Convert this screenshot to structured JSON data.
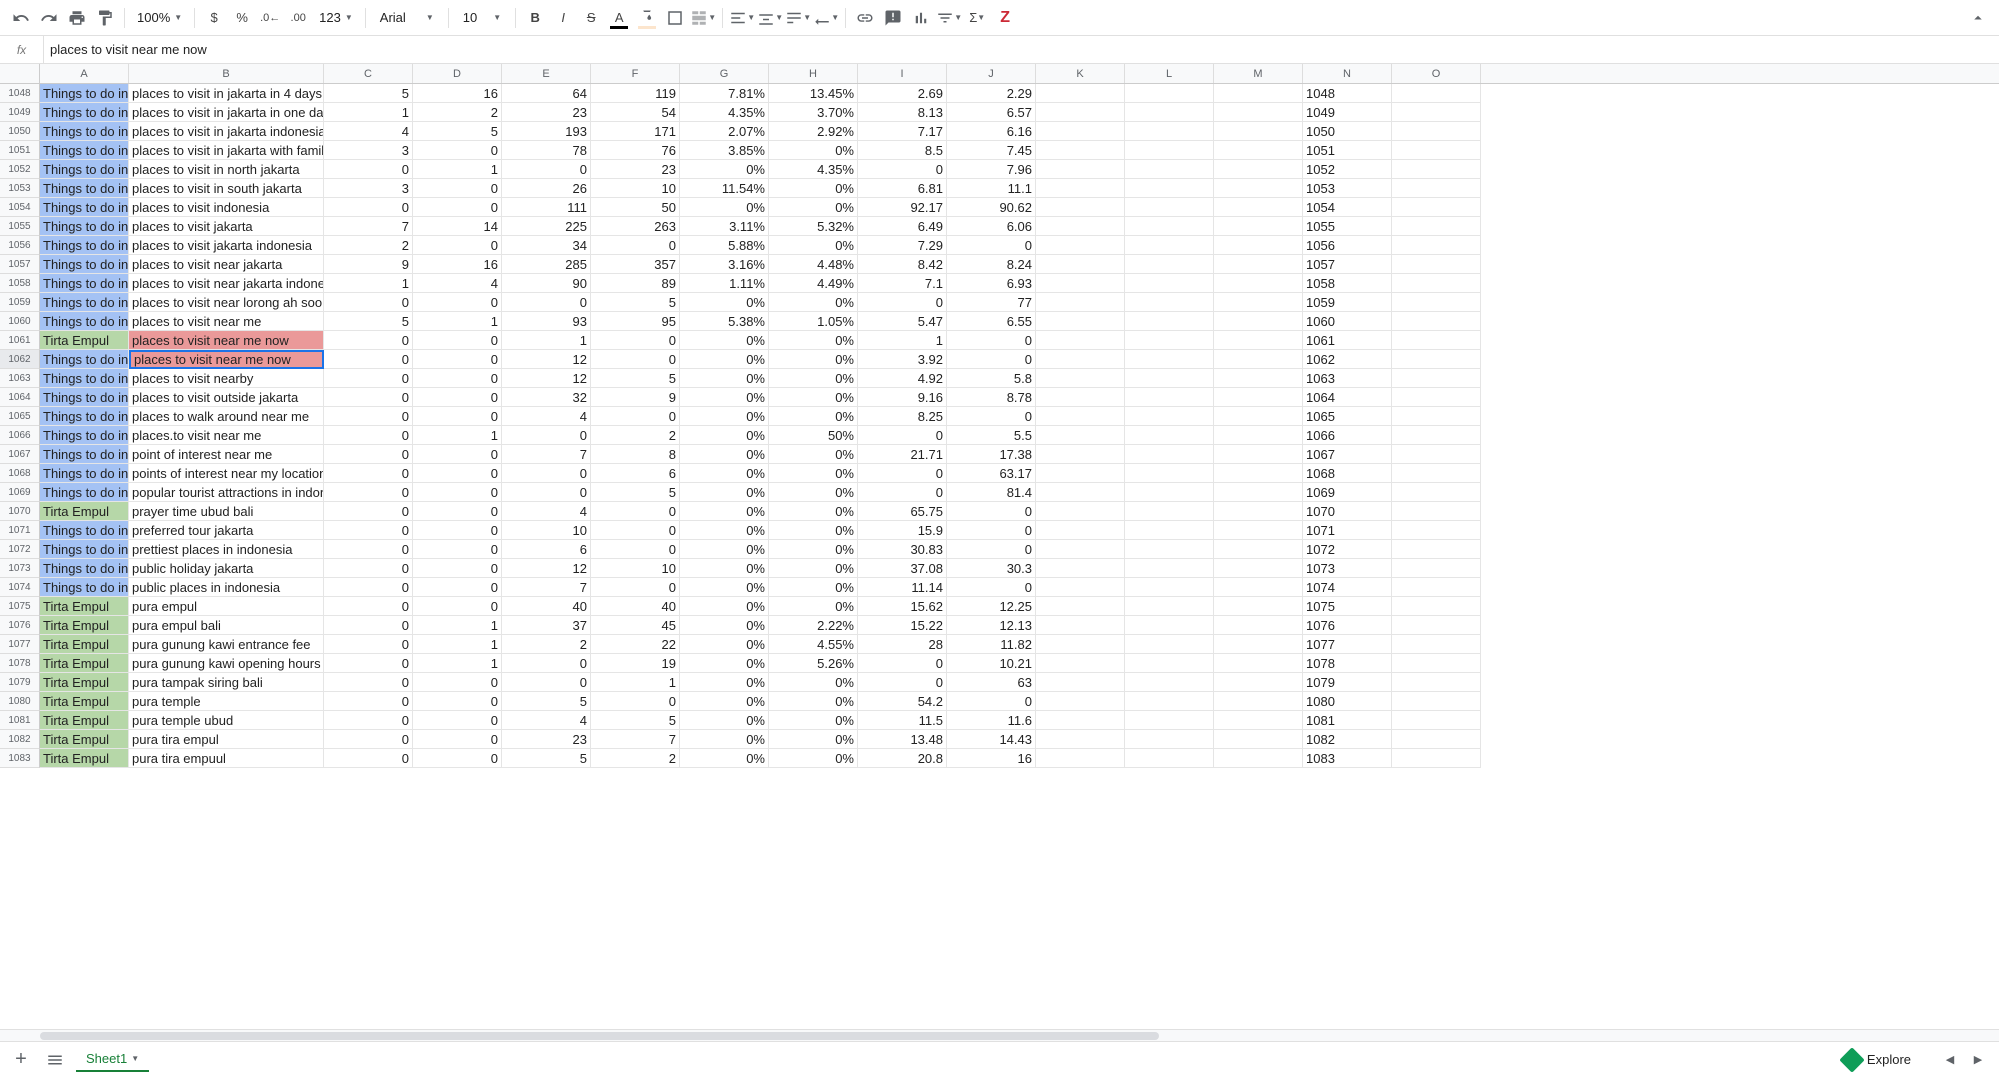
{
  "toolbar": {
    "zoom": "100%",
    "font": "Arial",
    "fontSize": "10",
    "numberFormat": "123"
  },
  "formulaBar": {
    "fx": "fx",
    "value": "places to visit near me now"
  },
  "columns": [
    "A",
    "B",
    "C",
    "D",
    "E",
    "F",
    "G",
    "H",
    "I",
    "J",
    "K",
    "L",
    "M",
    "N",
    "O"
  ],
  "columnWidths": {
    "A": 89,
    "B": 195,
    "default": 89
  },
  "selectedCell": "B1062",
  "rows": [
    {
      "n": 1048,
      "a": "Things to do in Ja",
      "abg": "blue",
      "b": "places to visit in jakarta in 4 days",
      "c": "5",
      "d": "16",
      "e": "64",
      "f": "119",
      "g": "7.81%",
      "h": "13.45%",
      "i": "2.69",
      "j": "2.29"
    },
    {
      "n": 1049,
      "a": "Things to do in Ja",
      "abg": "blue",
      "b": "places to visit in jakarta in one day",
      "c": "1",
      "d": "2",
      "e": "23",
      "f": "54",
      "g": "4.35%",
      "h": "3.70%",
      "i": "8.13",
      "j": "6.57"
    },
    {
      "n": 1050,
      "a": "Things to do in Ja",
      "abg": "blue",
      "b": "places to visit in jakarta indonesia",
      "c": "4",
      "d": "5",
      "e": "193",
      "f": "171",
      "g": "2.07%",
      "h": "2.92%",
      "i": "7.17",
      "j": "6.16"
    },
    {
      "n": 1051,
      "a": "Things to do in Ja",
      "abg": "blue",
      "b": "places to visit in jakarta with family",
      "c": "3",
      "d": "0",
      "e": "78",
      "f": "76",
      "g": "3.85%",
      "h": "0%",
      "i": "8.5",
      "j": "7.45"
    },
    {
      "n": 1052,
      "a": "Things to do in Ja",
      "abg": "blue",
      "b": "places to visit in north jakarta",
      "c": "0",
      "d": "1",
      "e": "0",
      "f": "23",
      "g": "0%",
      "h": "4.35%",
      "i": "0",
      "j": "7.96"
    },
    {
      "n": 1053,
      "a": "Things to do in Ja",
      "abg": "blue",
      "b": "places to visit in south jakarta",
      "c": "3",
      "d": "0",
      "e": "26",
      "f": "10",
      "g": "11.54%",
      "h": "0%",
      "i": "6.81",
      "j": "11.1"
    },
    {
      "n": 1054,
      "a": "Things to do in Ja",
      "abg": "blue",
      "b": "places to visit indonesia",
      "c": "0",
      "d": "0",
      "e": "111",
      "f": "50",
      "g": "0%",
      "h": "0%",
      "i": "92.17",
      "j": "90.62"
    },
    {
      "n": 1055,
      "a": "Things to do in Ja",
      "abg": "blue",
      "b": "places to visit jakarta",
      "c": "7",
      "d": "14",
      "e": "225",
      "f": "263",
      "g": "3.11%",
      "h": "5.32%",
      "i": "6.49",
      "j": "6.06"
    },
    {
      "n": 1056,
      "a": "Things to do in Ja",
      "abg": "blue",
      "b": "places to visit jakarta indonesia",
      "c": "2",
      "d": "0",
      "e": "34",
      "f": "0",
      "g": "5.88%",
      "h": "0%",
      "i": "7.29",
      "j": "0"
    },
    {
      "n": 1057,
      "a": "Things to do in Ja",
      "abg": "blue",
      "b": "places to visit near jakarta",
      "c": "9",
      "d": "16",
      "e": "285",
      "f": "357",
      "g": "3.16%",
      "h": "4.48%",
      "i": "8.42",
      "j": "8.24"
    },
    {
      "n": 1058,
      "a": "Things to do in Ja",
      "abg": "blue",
      "b": "places to visit near jakarta indonesia",
      "c": "1",
      "d": "4",
      "e": "90",
      "f": "89",
      "g": "1.11%",
      "h": "4.49%",
      "i": "7.1",
      "j": "6.93"
    },
    {
      "n": 1059,
      "a": "Things to do in Ja",
      "abg": "blue",
      "b": "places to visit near lorong ah soo",
      "c": "0",
      "d": "0",
      "e": "0",
      "f": "5",
      "g": "0%",
      "h": "0%",
      "i": "0",
      "j": "77"
    },
    {
      "n": 1060,
      "a": "Things to do in Ja",
      "abg": "blue",
      "b": "places to visit near me",
      "c": "5",
      "d": "1",
      "e": "93",
      "f": "95",
      "g": "5.38%",
      "h": "1.05%",
      "i": "5.47",
      "j": "6.55"
    },
    {
      "n": 1061,
      "a": "Tirta Empul",
      "abg": "green",
      "b": "places to visit near me now",
      "bbg": "red",
      "c": "0",
      "d": "0",
      "e": "1",
      "f": "0",
      "g": "0%",
      "h": "0%",
      "i": "1",
      "j": "0"
    },
    {
      "n": 1062,
      "a": "Things to do in Ja",
      "abg": "blue",
      "b": "places to visit near me now",
      "bbg": "red",
      "selected": true,
      "c": "0",
      "d": "0",
      "e": "12",
      "f": "0",
      "g": "0%",
      "h": "0%",
      "i": "3.92",
      "j": "0"
    },
    {
      "n": 1063,
      "a": "Things to do in Ja",
      "abg": "blue",
      "b": "places to visit nearby",
      "c": "0",
      "d": "0",
      "e": "12",
      "f": "5",
      "g": "0%",
      "h": "0%",
      "i": "4.92",
      "j": "5.8"
    },
    {
      "n": 1064,
      "a": "Things to do in Ja",
      "abg": "blue",
      "b": "places to visit outside jakarta",
      "c": "0",
      "d": "0",
      "e": "32",
      "f": "9",
      "g": "0%",
      "h": "0%",
      "i": "9.16",
      "j": "8.78"
    },
    {
      "n": 1065,
      "a": "Things to do in Ja",
      "abg": "blue",
      "b": "places to walk around near me",
      "c": "0",
      "d": "0",
      "e": "4",
      "f": "0",
      "g": "0%",
      "h": "0%",
      "i": "8.25",
      "j": "0"
    },
    {
      "n": 1066,
      "a": "Things to do in Ja",
      "abg": "blue",
      "b": "places.to visit near me",
      "c": "0",
      "d": "1",
      "e": "0",
      "f": "2",
      "g": "0%",
      "h": "50%",
      "i": "0",
      "j": "5.5"
    },
    {
      "n": 1067,
      "a": "Things to do in Ja",
      "abg": "blue",
      "b": "point of interest near me",
      "c": "0",
      "d": "0",
      "e": "7",
      "f": "8",
      "g": "0%",
      "h": "0%",
      "i": "21.71",
      "j": "17.38"
    },
    {
      "n": 1068,
      "a": "Things to do in Ja",
      "abg": "blue",
      "b": "points of interest near my location",
      "c": "0",
      "d": "0",
      "e": "0",
      "f": "6",
      "g": "0%",
      "h": "0%",
      "i": "0",
      "j": "63.17"
    },
    {
      "n": 1069,
      "a": "Things to do in Ja",
      "abg": "blue",
      "b": "popular tourist attractions in indonesia",
      "c": "0",
      "d": "0",
      "e": "0",
      "f": "5",
      "g": "0%",
      "h": "0%",
      "i": "0",
      "j": "81.4"
    },
    {
      "n": 1070,
      "a": "Tirta Empul",
      "abg": "green",
      "b": "prayer time ubud bali",
      "c": "0",
      "d": "0",
      "e": "4",
      "f": "0",
      "g": "0%",
      "h": "0%",
      "i": "65.75",
      "j": "0"
    },
    {
      "n": 1071,
      "a": "Things to do in Ja",
      "abg": "blue",
      "b": "preferred tour jakarta",
      "c": "0",
      "d": "0",
      "e": "10",
      "f": "0",
      "g": "0%",
      "h": "0%",
      "i": "15.9",
      "j": "0"
    },
    {
      "n": 1072,
      "a": "Things to do in Ja",
      "abg": "blue",
      "b": "prettiest places in indonesia",
      "c": "0",
      "d": "0",
      "e": "6",
      "f": "0",
      "g": "0%",
      "h": "0%",
      "i": "30.83",
      "j": "0"
    },
    {
      "n": 1073,
      "a": "Things to do in Ja",
      "abg": "blue",
      "b": "public holiday jakarta",
      "c": "0",
      "d": "0",
      "e": "12",
      "f": "10",
      "g": "0%",
      "h": "0%",
      "i": "37.08",
      "j": "30.3"
    },
    {
      "n": 1074,
      "a": "Things to do in Ja",
      "abg": "blue",
      "b": "public places in indonesia",
      "c": "0",
      "d": "0",
      "e": "7",
      "f": "0",
      "g": "0%",
      "h": "0%",
      "i": "11.14",
      "j": "0"
    },
    {
      "n": 1075,
      "a": "Tirta Empul",
      "abg": "green",
      "b": "pura empul",
      "c": "0",
      "d": "0",
      "e": "40",
      "f": "40",
      "g": "0%",
      "h": "0%",
      "i": "15.62",
      "j": "12.25"
    },
    {
      "n": 1076,
      "a": "Tirta Empul",
      "abg": "green",
      "b": "pura empul bali",
      "c": "0",
      "d": "1",
      "e": "37",
      "f": "45",
      "g": "0%",
      "h": "2.22%",
      "i": "15.22",
      "j": "12.13"
    },
    {
      "n": 1077,
      "a": "Tirta Empul",
      "abg": "green",
      "b": "pura gunung kawi entrance fee",
      "c": "0",
      "d": "1",
      "e": "2",
      "f": "22",
      "g": "0%",
      "h": "4.55%",
      "i": "28",
      "j": "11.82"
    },
    {
      "n": 1078,
      "a": "Tirta Empul",
      "abg": "green",
      "b": "pura gunung kawi opening hours",
      "c": "0",
      "d": "1",
      "e": "0",
      "f": "19",
      "g": "0%",
      "h": "5.26%",
      "i": "0",
      "j": "10.21"
    },
    {
      "n": 1079,
      "a": "Tirta Empul",
      "abg": "green",
      "b": "pura tampak siring bali",
      "c": "0",
      "d": "0",
      "e": "0",
      "f": "1",
      "g": "0%",
      "h": "0%",
      "i": "0",
      "j": "63"
    },
    {
      "n": 1080,
      "a": "Tirta Empul",
      "abg": "green",
      "b": "pura temple",
      "c": "0",
      "d": "0",
      "e": "5",
      "f": "0",
      "g": "0%",
      "h": "0%",
      "i": "54.2",
      "j": "0"
    },
    {
      "n": 1081,
      "a": "Tirta Empul",
      "abg": "green",
      "b": "pura temple ubud",
      "c": "0",
      "d": "0",
      "e": "4",
      "f": "5",
      "g": "0%",
      "h": "0%",
      "i": "11.5",
      "j": "11.6"
    },
    {
      "n": 1082,
      "a": "Tirta Empul",
      "abg": "green",
      "b": "pura tira empul",
      "c": "0",
      "d": "0",
      "e": "23",
      "f": "7",
      "g": "0%",
      "h": "0%",
      "i": "13.48",
      "j": "14.43"
    },
    {
      "n": 1083,
      "a": "Tirta Empul",
      "abg": "green",
      "b": "pura tira empuul",
      "c": "0",
      "d": "0",
      "e": "5",
      "f": "2",
      "g": "0%",
      "h": "0%",
      "i": "20.8",
      "j": "16"
    }
  ],
  "sheetTabs": {
    "active": "Sheet1"
  },
  "explore": {
    "label": "Explore"
  }
}
